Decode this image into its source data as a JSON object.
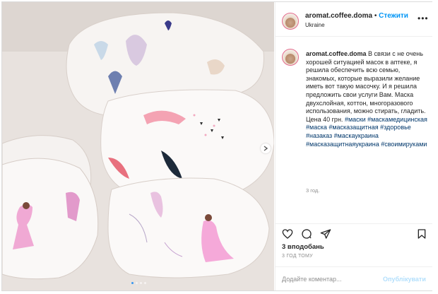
{
  "post": {
    "username": "aromat.coffee.doma",
    "separator": "•",
    "follow_label": "Стежити",
    "location": "Ukraine",
    "more_label": "•••",
    "caption_user": "aromat.coffee.doma",
    "caption_text": "В связи с не очень хорошей ситуацией масок в аптеке, я решила обеспечить всю семью, знакомых, которые выразили желание иметь вот такую масочку. И я решила предложить свои услуги Вам. Маска двухслойная, коттон, многоразового использования, можно стирать, гладить. Цена 40 грн.",
    "hashtags": "#маски #маскамедицинская #маска #масказащитная #здоровье #назаказ #маскаукраина #масказащитнаяукраина #своимируками",
    "caption_age": "3 год.",
    "likes": "3 вподобань",
    "timestamp": "3 ГОД ТОМУ",
    "comment_placeholder": "Додайте коментар...",
    "post_button": "Опублікувати"
  },
  "icons": {
    "heart": "heart-icon",
    "comment": "comment-icon",
    "share": "share-icon",
    "save": "bookmark-icon",
    "more": "more-icon",
    "next": "chevron-right-icon"
  },
  "colors": {
    "link_blue": "#0095f6",
    "hashtag": "#00376b",
    "muted": "#8e8e8e",
    "post_disabled": "#b2dffc"
  },
  "carousel": {
    "count": 4,
    "active_index": 0
  }
}
